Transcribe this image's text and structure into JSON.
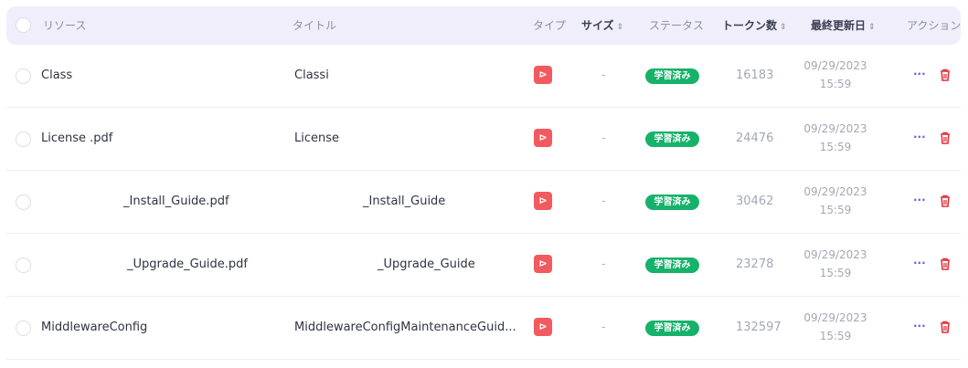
{
  "header": {
    "resource": "リソース",
    "title": "タイトル",
    "type": "タイプ",
    "size": "サイズ",
    "status": "ステータス",
    "tokens": "トークン数",
    "updated": "最終更新日",
    "actions": "アクション",
    "sort_icon": "sort-icon"
  },
  "rows": [
    {
      "resource": "Class",
      "title": "Classi",
      "type_icon": "pdf-icon",
      "type_glyph": "⊳",
      "size": "-",
      "status": "学習済み",
      "tokens": "16183",
      "date": "09/29/2023",
      "time": "15:59",
      "more": "···"
    },
    {
      "resource": "License                                    .pdf",
      "title": "License",
      "type_icon": "pdf-icon",
      "type_glyph": "⊳",
      "size": "-",
      "status": "学習済み",
      "tokens": "24476",
      "date": "09/29/2023",
      "time": "15:59",
      "more": "···"
    },
    {
      "resource": "_Install_Guide.pdf",
      "title": "_Install_Guide",
      "type_icon": "pdf-icon",
      "type_glyph": "⊳",
      "size": "-",
      "status": "学習済み",
      "tokens": "30462",
      "date": "09/29/2023",
      "time": "15:59",
      "more": "···"
    },
    {
      "resource": "_Upgrade_Guide.pdf",
      "title": "_Upgrade_Guide",
      "type_icon": "pdf-icon",
      "type_glyph": "⊳",
      "size": "-",
      "status": "学習済み",
      "tokens": "23278",
      "date": "09/29/2023",
      "time": "15:59",
      "more": "···"
    },
    {
      "resource": "MiddlewareConfig",
      "title": "MiddlewareConfigMaintenanceGuid...",
      "type_icon": "pdf-icon",
      "type_glyph": "⊳",
      "size": "-",
      "status": "学習済み",
      "tokens": "132597",
      "date": "09/29/2023",
      "time": "15:59",
      "more": "···"
    }
  ],
  "colors": {
    "header_bg": "#f0eefb",
    "pdf_red": "#f25a5f",
    "status_green": "#17b26a",
    "more_purple": "#6b5ce7",
    "trash_red": "#e0303a"
  }
}
